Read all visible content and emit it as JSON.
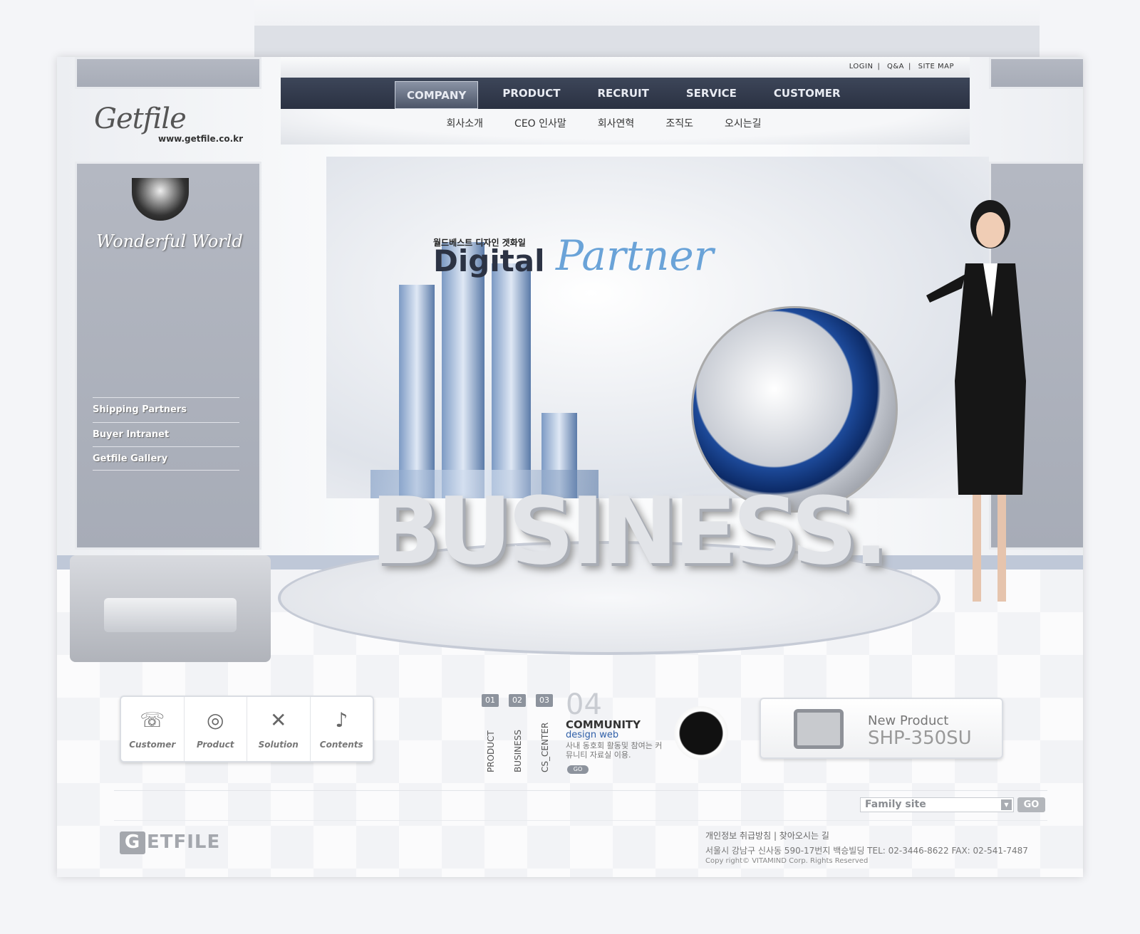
{
  "header": {
    "top_links": [
      "LOGIN",
      "Q&A",
      "SITE MAP"
    ],
    "nav": [
      "COMPANY",
      "PRODUCT",
      "RECRUIT",
      "SERVICE",
      "CUSTOMER"
    ],
    "nav_active": "COMPANY",
    "subnav": [
      "회사소개",
      "CEO 인사말",
      "회사연혁",
      "조직도",
      "오시는길"
    ]
  },
  "sidebar": {
    "logo_script": "Getfile",
    "logo_url": "www.getfile.co.kr",
    "banner": "Wonderful World",
    "menu": [
      "Shipping Partners",
      "Buyer Intranet",
      "Getfile Gallery"
    ]
  },
  "hero": {
    "kicker": "월드베스트 디자인 겟화일",
    "title_bold": "Digital",
    "title_script": "Partner",
    "big_word": "BUSINESS."
  },
  "quick_links": [
    {
      "label": "Customer",
      "icon": "phone-icon"
    },
    {
      "label": "Product",
      "icon": "target-icon"
    },
    {
      "label": "Solution",
      "icon": "tools-icon"
    },
    {
      "label": "Contents",
      "icon": "music-note-icon"
    }
  ],
  "tabs": {
    "items": [
      {
        "num": "01",
        "label": "PRODUCT"
      },
      {
        "num": "02",
        "label": "BUSINESS"
      },
      {
        "num": "03",
        "label": "CS_CENTER"
      }
    ],
    "active_num": "04",
    "title": "COMMUNITY",
    "subtitle": "design web",
    "desc": "사내 동호회 활동및 참여는 커뮤니티 자료실 이용.",
    "go": "GO"
  },
  "new_product": {
    "label": "New Product",
    "model": "SHP-350SU"
  },
  "footer": {
    "family_site": "Family site",
    "go": "GO",
    "logo": "ETFILE",
    "logo_g": "G",
    "links": "개인정보 취급방침  |  찾아오시는 길",
    "address": "서울시 강남구 신사동 590-17번지 백승빌딩 TEL: 02-3446-8622   FAX: 02-541-7487",
    "copyright": "Copy right© VITAMIND Corp. Rights Reserved"
  },
  "colors": {
    "nav_bg": "#2f3647",
    "accent_blue": "#2f5fa8",
    "panel": "#aeb2bc"
  }
}
